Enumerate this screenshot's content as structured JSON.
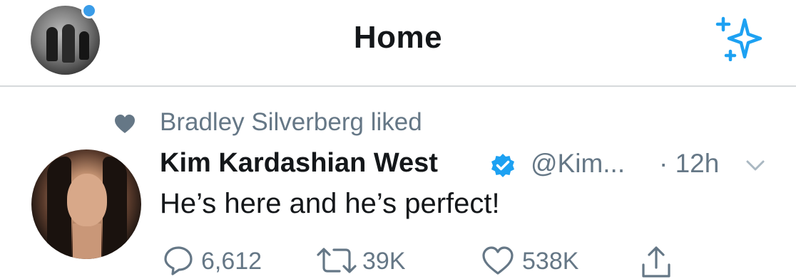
{
  "header": {
    "title": "Home",
    "avatar_icon": "profile-avatar",
    "new_indicator_color": "#3a9ce8",
    "sparkle_icon": "sparkle-icon",
    "accent_color": "#1da1f2"
  },
  "social_context": {
    "icon": "heart-icon",
    "text": "Bradley Silverberg liked"
  },
  "tweet": {
    "author_name": "Kim Kardashian West",
    "verified_icon": "verified-badge-icon",
    "handle": "@Kim...",
    "timestamp": "· 12h",
    "menu_icon": "chevron-down-icon",
    "text": "He’s here and he’s perfect!",
    "actions": {
      "replies": "6,612",
      "retweets": "39K",
      "likes": "538K",
      "share_icon": "share-icon"
    }
  }
}
